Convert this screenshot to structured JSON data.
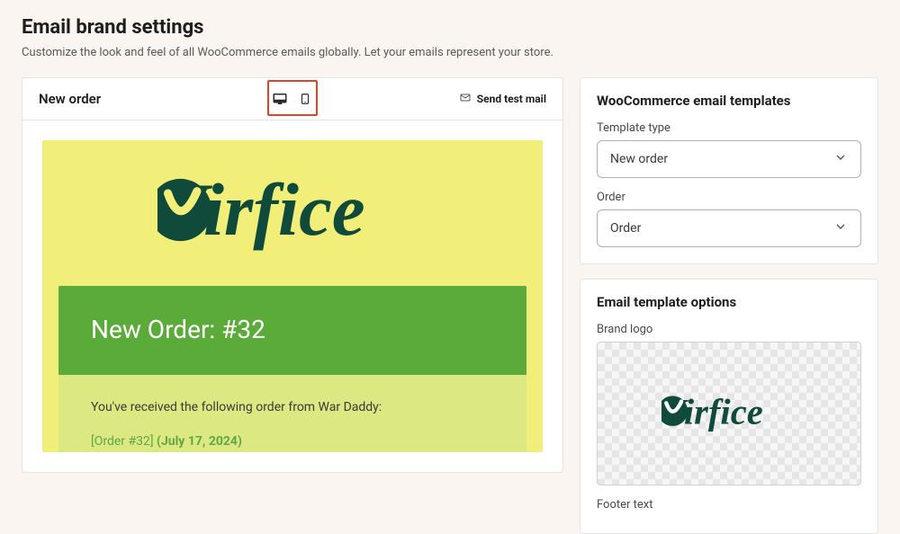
{
  "page": {
    "title": "Email brand settings",
    "subtitle": "Customize the look and feel of all WooCommerce emails globally. Let your emails represent your store."
  },
  "preview": {
    "title": "New order",
    "send_test_label": "Send test mail",
    "device_desktop_icon": "desktop-icon",
    "device_mobile_icon": "mobile-icon"
  },
  "email": {
    "brand_name": "Virfice",
    "heading": "New Order: #32",
    "intro": "You've received the following order from War Daddy:",
    "order_link": "[Order #32]",
    "order_date": "(July 17, 2024)"
  },
  "sidebar_templates": {
    "heading": "WooCommerce email templates",
    "template_type_label": "Template type",
    "template_type_value": "New order",
    "order_label": "Order",
    "order_value": "Order"
  },
  "sidebar_options": {
    "heading": "Email template options",
    "brand_logo_label": "Brand logo",
    "footer_text_label": "Footer text"
  },
  "colors": {
    "brand_dark": "#0f4a3b",
    "email_bg": "#f1ee79",
    "email_header": "#5bab3b",
    "email_body": "#dce881",
    "highlight_border": "#d9472b"
  }
}
